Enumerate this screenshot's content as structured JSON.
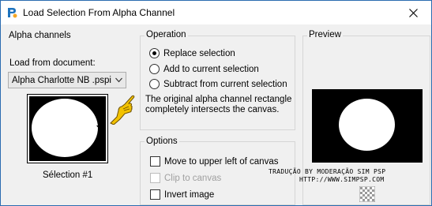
{
  "window": {
    "title": "Load Selection From Alpha Channel",
    "close_glyph": "close-icon"
  },
  "alpha_channels": {
    "heading": "Alpha channels",
    "load_from_label": "Load from document:",
    "document_value": "Alpha Charlotte NB .pspi",
    "selection_name": "Sélection #1"
  },
  "operation": {
    "heading": "Operation",
    "options": [
      {
        "label": "Replace selection",
        "checked": true
      },
      {
        "label": "Add to current selection",
        "checked": false
      },
      {
        "label": "Subtract from current selection",
        "checked": false
      }
    ],
    "description": "The original alpha channel rectangle completely intersects the canvas."
  },
  "options": {
    "heading": "Options",
    "items": [
      {
        "label": "Move to upper left of canvas",
        "checked": false,
        "enabled": true
      },
      {
        "label": "Clip to canvas",
        "checked": false,
        "enabled": false
      },
      {
        "label": "Invert image",
        "checked": false,
        "enabled": true
      }
    ]
  },
  "preview": {
    "heading": "Preview"
  },
  "watermark": {
    "line1": "TRADUÇÃO BY MODERAÇÃO SIM PSP",
    "line2": "HTTP://WWW.SIMPSP.COM"
  },
  "colors": {
    "window_border": "#2b6cb0",
    "background": "#f0f0f0",
    "hand_yellow": "#f2c200"
  }
}
